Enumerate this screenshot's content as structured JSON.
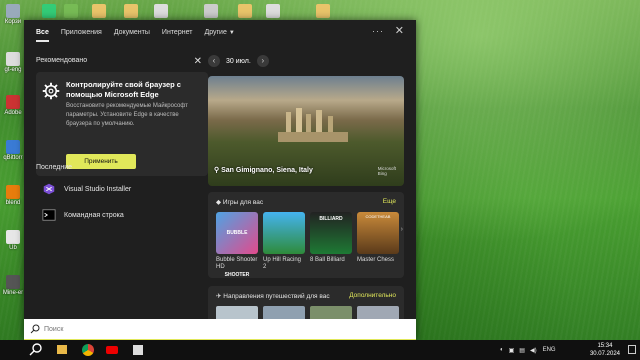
{
  "tabs": [
    {
      "label": "Все"
    },
    {
      "label": "Приложения"
    },
    {
      "label": "Документы"
    },
    {
      "label": "Интернет"
    },
    {
      "label": "Другие"
    }
  ],
  "tabs_more": "···",
  "recommended": {
    "section_title": "Рекомендовано",
    "card_title": "Контролируйте свой браузер с помощью Microsoft Edge",
    "card_body": "Восстановите рекомендуемые Майкрософт параметры. Установите Edge в качестве браузера по умолчанию.",
    "button_label": "Применить"
  },
  "recent": {
    "section_title": "Последние",
    "items": [
      {
        "label": "Visual Studio Installer",
        "icon": "visual-studio-installer-icon"
      },
      {
        "label": "Командная строка",
        "icon": "command-prompt-icon"
      }
    ]
  },
  "date": "30 июл.",
  "hero": {
    "place": "San Gimignano, Siena, Italy",
    "brand_line1": "Microsoft",
    "brand_line2": "Bing"
  },
  "games": {
    "title": "Игры для вас",
    "see_all": "Еще",
    "items": [
      {
        "name": "Bubble Shooter HD",
        "thumb_label": "BUBBLE SHOOTER"
      },
      {
        "name": "Up Hill Racing 2"
      },
      {
        "name": "8 Ball Billiard",
        "thumb_label": "BILLIARD"
      },
      {
        "name": "Master Chess",
        "thumb_label": "CODETHEAB"
      }
    ]
  },
  "travel": {
    "title": "Направления путешествий для вас",
    "more": "Дополнительно"
  },
  "search": {
    "placeholder": "Поиск"
  },
  "desktop_icons": [
    {
      "label": "Корзи"
    },
    {
      "label": "gt-eng"
    },
    {
      "label": "Adobe"
    },
    {
      "label": "qBittorr"
    },
    {
      "label": "blend"
    },
    {
      "label": "Ub"
    },
    {
      "label": "Mine-er"
    }
  ],
  "tray": {
    "language": "ENG",
    "time": "15:34",
    "date": "30.07.2024"
  },
  "colors": {
    "accent": "#e1e85a",
    "panel": "#1f1f1f",
    "card": "#2b2b2b"
  }
}
